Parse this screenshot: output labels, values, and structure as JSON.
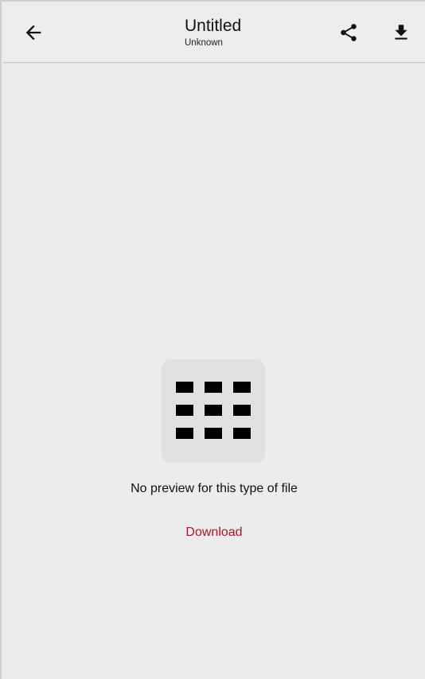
{
  "header": {
    "title": "Untitled",
    "subtitle": "Unknown",
    "back_icon": "arrow-left-icon",
    "share_icon": "share-icon",
    "download_icon": "download-icon"
  },
  "content": {
    "file_icon": "grid-icon",
    "message": "No preview for this type of file",
    "download_label": "Download"
  },
  "colors": {
    "accent": "#b3122e",
    "background": "#ececec",
    "icon_tile": "#e1e1e1"
  }
}
